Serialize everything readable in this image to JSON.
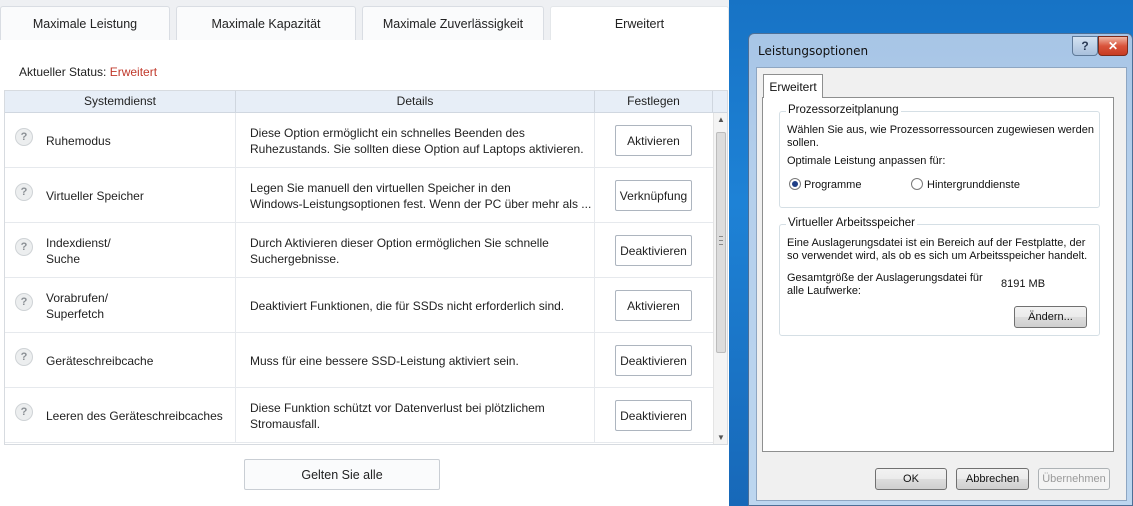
{
  "tabs": [
    {
      "label": "Maximale Leistung"
    },
    {
      "label": "Maximale Kapazität"
    },
    {
      "label": "Maximale Zuverlässigkeit"
    },
    {
      "label": "Erweitert"
    }
  ],
  "status": {
    "label": "Aktueller Status:",
    "value": "Erweitert"
  },
  "table": {
    "headers": [
      "Systemdienst",
      "Details",
      "Festlegen"
    ],
    "rows": [
      {
        "service": [
          "Ruhemodus"
        ],
        "details": [
          "Diese Option ermöglicht ein schnelles Beenden des",
          "Ruhezustands. Sie sollten diese Option auf Laptops aktivieren."
        ],
        "action": "Aktivieren"
      },
      {
        "service": [
          "Virtueller Speicher"
        ],
        "details": [
          "Legen Sie manuell den virtuellen Speicher in den",
          "Windows-Leistungsoptionen fest. Wenn der PC über mehr als ..."
        ],
        "action": "Verknüpfung"
      },
      {
        "service": [
          "Indexdienst/",
          "Suche"
        ],
        "details": [
          "Durch Aktivieren dieser Option ermöglichen Sie schnelle",
          "Suchergebnisse."
        ],
        "action": "Deaktivieren"
      },
      {
        "service": [
          "Vorabrufen/",
          "Superfetch"
        ],
        "details": [
          "Deaktiviert Funktionen, die für SSDs nicht erforderlich sind."
        ],
        "action": "Aktivieren"
      },
      {
        "service": [
          "Geräteschreibcache"
        ],
        "details": [
          "Muss für eine bessere SSD-Leistung aktiviert sein."
        ],
        "action": "Deaktivieren"
      },
      {
        "service": [
          "Leeren des Geräteschreibcaches"
        ],
        "details": [
          "Diese Funktion schützt vor Datenverlust bei plötzlichem",
          "Stromausfall."
        ],
        "action": "Deaktivieren"
      }
    ]
  },
  "apply_all": "Gelten Sie alle",
  "dialog": {
    "title": "Leistungsoptionen",
    "help": "?",
    "close": "✕",
    "tab": "Erweitert",
    "cpu_group": {
      "legend": "Prozessorzeitplanung",
      "desc": [
        "Wählen Sie aus, wie Prozessorressourcen zugewiesen werden",
        "sollen."
      ],
      "adjust": "Optimale Leistung anpassen für:",
      "radio_programs": "Programme",
      "radio_background": "Hintergrunddienste",
      "selected": "Programme"
    },
    "vm_group": {
      "legend": "Virtueller Arbeitsspeicher",
      "desc": [
        "Eine Auslagerungsdatei ist ein Bereich auf der Festplatte, der",
        "so verwendet wird, als ob es sich um Arbeitsspeicher handelt."
      ],
      "total_label": [
        "Gesamtgröße der Auslagerungsdatei für",
        "alle Laufwerke:"
      ],
      "total_value": "8191 MB",
      "change_button": "Ändern..."
    },
    "buttons": {
      "ok": "OK",
      "cancel": "Abbrechen",
      "apply": "Übernehmen"
    }
  }
}
